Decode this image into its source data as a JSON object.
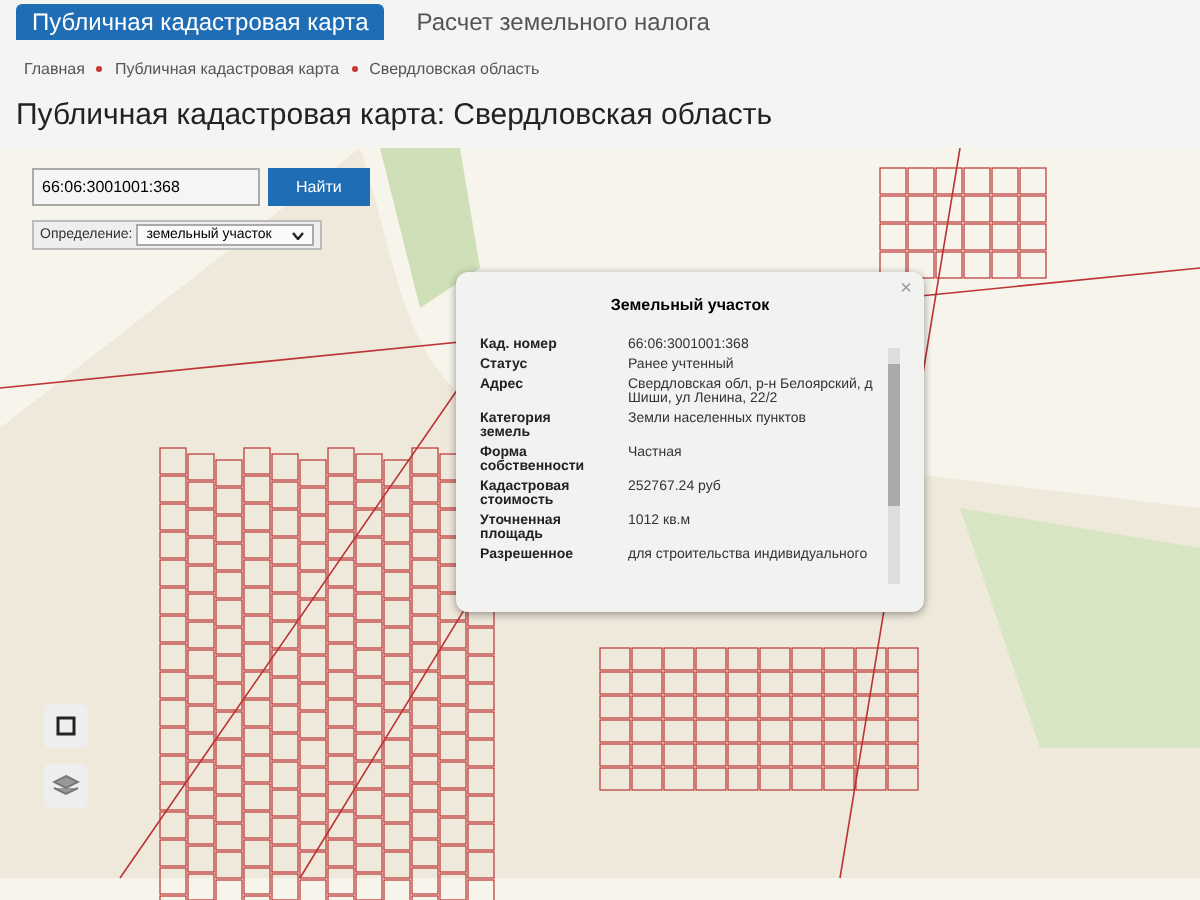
{
  "tabs": [
    {
      "label": "Публичная кадастровая карта",
      "selected": true
    },
    {
      "label": "Расчет земельного налога",
      "selected": false
    }
  ],
  "breadcrumbs": [
    "Главная",
    "Публичная кадастровая карта",
    "Свердловская область"
  ],
  "title": "Публичная кадастровая карта: Свердловская область",
  "search": {
    "value": "66:06:3001001:368",
    "button": "Найти"
  },
  "definition": {
    "label": "Определение:",
    "value": "земельный участок"
  },
  "popup": {
    "title": "Земельный участок",
    "close": "×",
    "rows": [
      {
        "label": "Кад. номер",
        "value": "66:06:3001001:368"
      },
      {
        "label": "Статус",
        "value": "Ранее учтенный"
      },
      {
        "label": "Адрес",
        "value": "Свердловская обл, р-н Белоярский, д Шиши, ул Ленина, 22/2"
      },
      {
        "label": "Категория земель",
        "value": "Земли населенных пунктов"
      },
      {
        "label": "Форма собственности",
        "value": "Частная"
      },
      {
        "label": "Кадастровая стоимость",
        "value": "252767.24 руб"
      },
      {
        "label": "Уточненная площадь",
        "value": "1012 кв.м"
      },
      {
        "label": "Разрешенное",
        "value": "для строительства индивидуального"
      }
    ]
  }
}
